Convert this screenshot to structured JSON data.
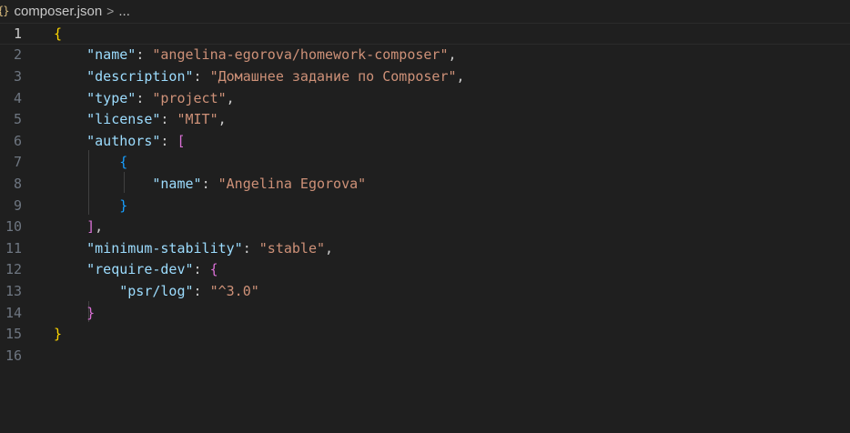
{
  "breadcrumb": {
    "file_icon": "{}",
    "file_name": "composer.json",
    "separator": ">",
    "more": "..."
  },
  "editor": {
    "active_line": 1,
    "lines": [
      {
        "num": "1",
        "tokens": [
          {
            "t": "{",
            "c": "b1"
          }
        ]
      },
      {
        "num": "2",
        "tokens": [
          {
            "t": "    ",
            "c": "punc"
          },
          {
            "t": "\"name\"",
            "c": "key"
          },
          {
            "t": ": ",
            "c": "punc"
          },
          {
            "t": "\"angelina-egorova/homework-composer\"",
            "c": "str"
          },
          {
            "t": ",",
            "c": "punc"
          }
        ]
      },
      {
        "num": "3",
        "tokens": [
          {
            "t": "    ",
            "c": "punc"
          },
          {
            "t": "\"description\"",
            "c": "key"
          },
          {
            "t": ": ",
            "c": "punc"
          },
          {
            "t": "\"Домашнее задание по Composer\"",
            "c": "str"
          },
          {
            "t": ",",
            "c": "punc"
          }
        ]
      },
      {
        "num": "4",
        "tokens": [
          {
            "t": "    ",
            "c": "punc"
          },
          {
            "t": "\"type\"",
            "c": "key"
          },
          {
            "t": ": ",
            "c": "punc"
          },
          {
            "t": "\"project\"",
            "c": "str"
          },
          {
            "t": ",",
            "c": "punc"
          }
        ]
      },
      {
        "num": "5",
        "tokens": [
          {
            "t": "    ",
            "c": "punc"
          },
          {
            "t": "\"license\"",
            "c": "key"
          },
          {
            "t": ": ",
            "c": "punc"
          },
          {
            "t": "\"MIT\"",
            "c": "str"
          },
          {
            "t": ",",
            "c": "punc"
          }
        ]
      },
      {
        "num": "6",
        "tokens": [
          {
            "t": "    ",
            "c": "punc"
          },
          {
            "t": "\"authors\"",
            "c": "key"
          },
          {
            "t": ": ",
            "c": "punc"
          },
          {
            "t": "[",
            "c": "b2"
          }
        ]
      },
      {
        "num": "7",
        "tokens": [
          {
            "t": "        ",
            "c": "punc"
          },
          {
            "t": "{",
            "c": "b3"
          }
        ]
      },
      {
        "num": "8",
        "tokens": [
          {
            "t": "            ",
            "c": "punc"
          },
          {
            "t": "\"name\"",
            "c": "key"
          },
          {
            "t": ": ",
            "c": "punc"
          },
          {
            "t": "\"Angelina Egorova\"",
            "c": "str"
          }
        ]
      },
      {
        "num": "9",
        "tokens": [
          {
            "t": "        ",
            "c": "punc"
          },
          {
            "t": "}",
            "c": "b3"
          }
        ]
      },
      {
        "num": "10",
        "tokens": [
          {
            "t": "    ",
            "c": "punc"
          },
          {
            "t": "]",
            "c": "b2"
          },
          {
            "t": ",",
            "c": "punc"
          }
        ]
      },
      {
        "num": "11",
        "tokens": [
          {
            "t": "    ",
            "c": "punc"
          },
          {
            "t": "\"minimum-stability\"",
            "c": "key"
          },
          {
            "t": ": ",
            "c": "punc"
          },
          {
            "t": "\"stable\"",
            "c": "str"
          },
          {
            "t": ",",
            "c": "punc"
          }
        ]
      },
      {
        "num": "12",
        "tokens": [
          {
            "t": "    ",
            "c": "punc"
          },
          {
            "t": "\"require-dev\"",
            "c": "key"
          },
          {
            "t": ": ",
            "c": "punc"
          },
          {
            "t": "{",
            "c": "b2"
          }
        ]
      },
      {
        "num": "13",
        "tokens": [
          {
            "t": "        ",
            "c": "punc"
          },
          {
            "t": "\"psr/log\"",
            "c": "key"
          },
          {
            "t": ": ",
            "c": "punc"
          },
          {
            "t": "\"^3.0\"",
            "c": "str"
          }
        ]
      },
      {
        "num": "14",
        "tokens": [
          {
            "t": "    ",
            "c": "punc"
          },
          {
            "t": "}",
            "c": "b2"
          }
        ]
      },
      {
        "num": "15",
        "tokens": [
          {
            "t": "}",
            "c": "b1"
          }
        ]
      },
      {
        "num": "16",
        "tokens": []
      }
    ]
  },
  "colors": {
    "background": "#1f1f1f",
    "key": "#9cdcfe",
    "string": "#ce9178",
    "bracket_level1": "#ffd700",
    "bracket_level2": "#da70d6",
    "bracket_level3": "#179fff"
  }
}
